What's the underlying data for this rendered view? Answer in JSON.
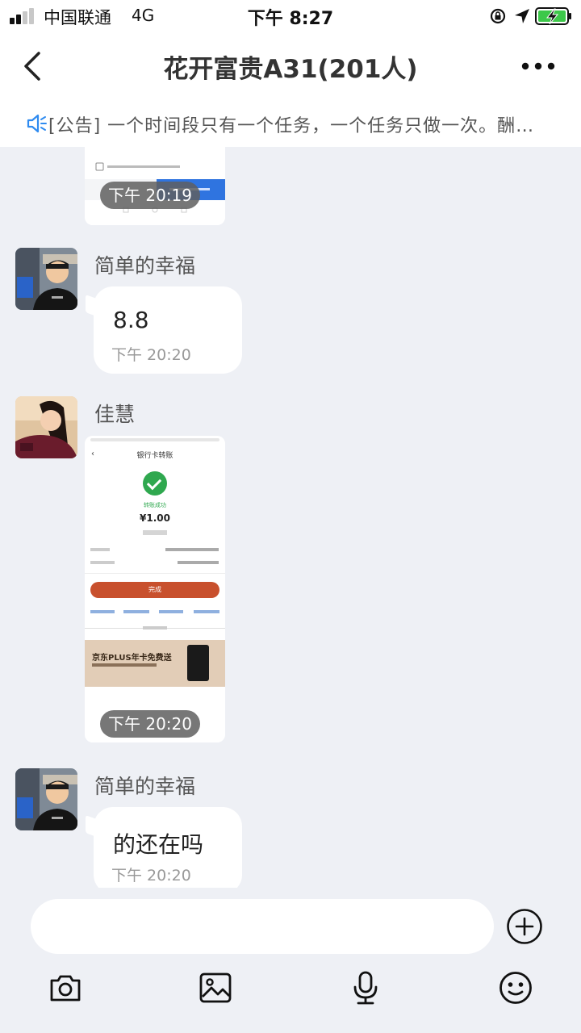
{
  "status_bar": {
    "carrier": "中国联通",
    "network": "4G",
    "time": "下午 8:27"
  },
  "header": {
    "title": "花开富贵A31(201人)"
  },
  "notice": {
    "text": "[公告] 一个时间段只有一个任务，一个任务只做一次。酬…"
  },
  "messages": [
    {
      "type": "image",
      "time": "下午 20:19"
    },
    {
      "type": "text",
      "sender": "简单的幸福",
      "text": "8.8",
      "time": "下午 20:20"
    },
    {
      "type": "image",
      "sender": "佳慧",
      "time": "下午 20:20",
      "receipt": {
        "title": "银行卡转账",
        "status": "转账成功",
        "amount": "¥1.00",
        "button": "完成",
        "banner_title": "京东PLUS年卡免费送"
      }
    },
    {
      "type": "text",
      "sender": "简单的幸福",
      "text": "的还在吗",
      "time": "下午 20:20"
    }
  ],
  "icons": {
    "back": "chevron-left-icon",
    "more": "more-icon",
    "notice": "speaker-icon",
    "plus": "plus-circle-icon",
    "camera": "camera-icon",
    "image": "image-icon",
    "voice": "microphone-icon",
    "emoji": "emoji-icon"
  }
}
